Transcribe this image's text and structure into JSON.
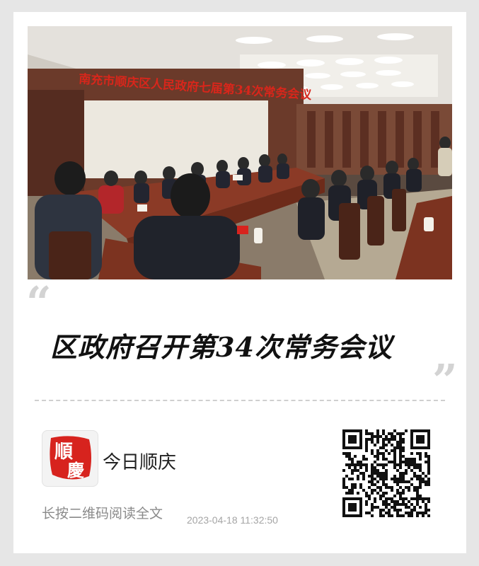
{
  "article": {
    "photo_banner_text": "南充市顺庆区人民政府七届第34次常务会议",
    "headline": "区政府召开第34次常务会议"
  },
  "quotes": {
    "open": "“",
    "close": "”"
  },
  "account": {
    "logo_text_top": "順",
    "logo_text_bottom": "慶",
    "name": "今日顺庆"
  },
  "footer": {
    "hint": "长按二维码阅读全文",
    "timestamp": "2023-04-18 11:32:50"
  },
  "colors": {
    "background": "#e6e6e6",
    "card": "#ffffff",
    "banner_red": "#d8261b",
    "logo_red": "#d7231e",
    "quote_grey": "#d3d3d3"
  },
  "icons": {
    "qr": "qr-code-icon",
    "logo": "shunqing-logo-icon"
  }
}
